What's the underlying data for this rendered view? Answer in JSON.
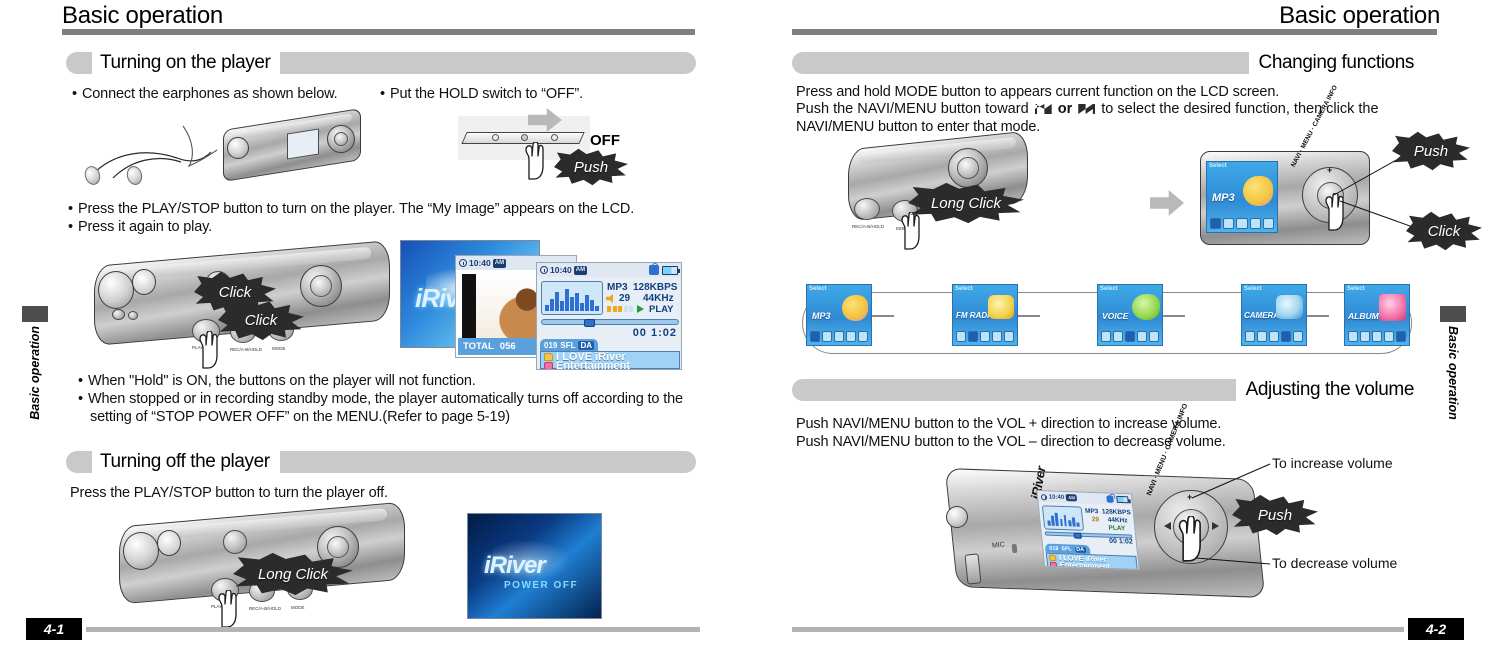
{
  "spread": {
    "left_page": {
      "running_head": "Basic operation",
      "folio": "4-1",
      "side_tab": "Basic operation",
      "sections": [
        {
          "title": "Turning on the player",
          "bullets": [
            "Connect the earphones as shown below.",
            "Put the HOLD switch to “OFF”.",
            "Press the PLAY/STOP button to turn on the player. The “My Image” appears on the LCD.",
            "Press it again to play."
          ],
          "notes": [
            "When \"Hold\" is ON, the buttons on the player will not function.",
            "When stopped or in recording standby mode, the player automatically turns off according to the setting of “STOP POWER OFF” on the MENU.(Refer to page 5-19)"
          ]
        },
        {
          "title": "Turning off the player",
          "body": "Press the PLAY/STOP button to turn the player off."
        }
      ],
      "callouts": {
        "hold_push": "Push",
        "hold_off": "OFF",
        "click_1": "Click",
        "click_2": "Click",
        "long_click": "Long Click"
      },
      "power_off_screen": {
        "logo": "iRiver",
        "caption": "POWER OFF"
      }
    },
    "right_page": {
      "running_head": "Basic operation",
      "folio": "4-2",
      "side_tab": "Basic operation",
      "sections": [
        {
          "title": "Changing functions",
          "body_line1": "Press and hold MODE button to appears current function on the LCD screen.",
          "body_line2_a": "Push the NAVI/MENU button toward",
          "body_line2_or": "or",
          "body_line2_b": "to select the desired function, then click the",
          "body_line3": "NAVI/MENU button to enter that mode."
        },
        {
          "title": "Adjusting the volume",
          "body": "Push NAVI/MENU button to the VOL + direction to increase volume.\nPush NAVI/MENU button to the VOL – direction to decrease volume."
        }
      ],
      "callouts": {
        "long_click": "Long Click",
        "push": "Push",
        "click": "Click",
        "volume_push": "Push",
        "increase": "To increase volume",
        "decrease": "To decrease volume"
      },
      "device_labels": {
        "mic": "MIC",
        "brand": "iRiver",
        "navi_arc": "NAVI · MENU · CAMERA INFO",
        "plus": "+",
        "minus": "–"
      },
      "function_tiles": [
        {
          "select": "Select",
          "name": "MP3",
          "active_icon": 0,
          "accent": "#f2c53d"
        },
        {
          "select": "Select",
          "name": "FM RADIO",
          "active_icon": 1,
          "accent": "#f3d14a"
        },
        {
          "select": "Select",
          "name": "VOICE",
          "active_icon": 2,
          "accent": "#8fd64a"
        },
        {
          "select": "Select",
          "name": "CAMERA",
          "active_icon": 3,
          "accent": "#9fd6ef"
        },
        {
          "select": "Select",
          "name": "ALBUM",
          "active_icon": 4,
          "accent": "#f46fa8"
        }
      ]
    }
  },
  "lcd_play_screen": {
    "clock": "10:40",
    "ampm": "AM",
    "codec": "MP3",
    "bitrate": "128KBPS",
    "volume": "29",
    "samplerate": "44KHz",
    "status": "PLAY",
    "elapsed": "00 1:02",
    "track_number": "019",
    "repeat_mode": "SFL",
    "tag_badge": "DA",
    "line1": "I LOVE iRiver",
    "line2": "Entertainment"
  },
  "lcd_photo_screen": {
    "clock": "10:40",
    "ampm": "AM",
    "total_label": "TOTAL",
    "total_count": "056"
  },
  "lcd_mp3_device_screen": {
    "select": "Select",
    "name": "MP3"
  },
  "colors": {
    "rule": "#808080",
    "section_bar": "#c9c9c9",
    "folio_bg": "#000000",
    "lcd_blue": "#3fa9e8",
    "lcd_deep": "#14407d"
  }
}
